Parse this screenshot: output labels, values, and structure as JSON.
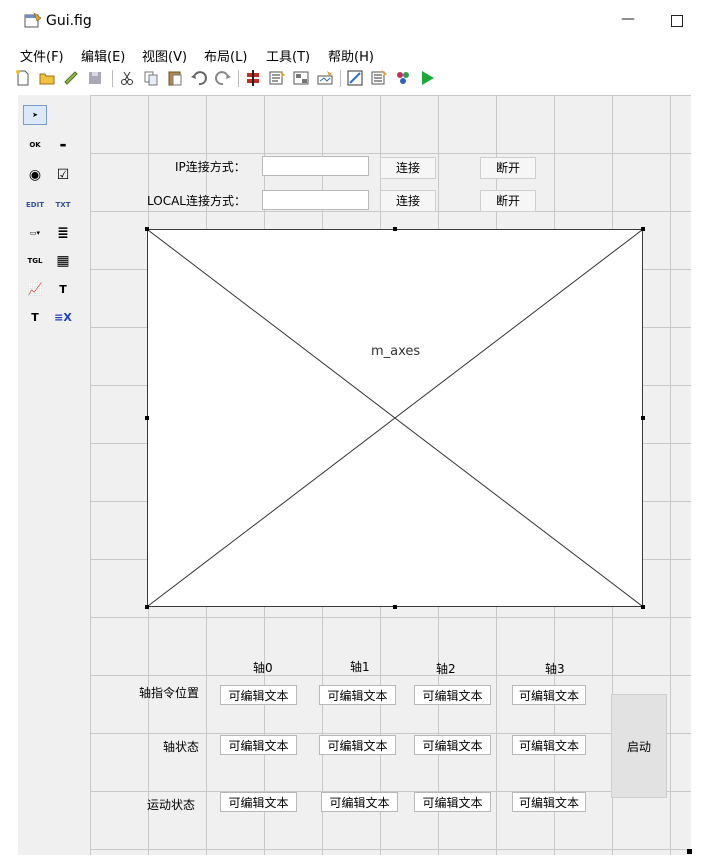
{
  "window": {
    "title": "Gui.fig",
    "minimize_glyph": "—"
  },
  "menu": [
    "文件(F)",
    "编辑(E)",
    "视图(V)",
    "布局(L)",
    "工具(T)",
    "帮助(H)"
  ],
  "toolbar_icons": [
    "new-file-icon",
    "open-folder-icon",
    "save-disk-icon",
    "cut-icon",
    "copy-icon",
    "paste-icon",
    "undo-icon",
    "redo-icon",
    "align-icon",
    "menu-editor-icon",
    "tab-order-icon",
    "toolbar-editor-icon",
    "editor-icon",
    "property-inspector-icon",
    "object-browser-icon",
    "run-icon"
  ],
  "palette": [
    {
      "name": "select-arrow-icon",
      "glyph": "➤"
    },
    {
      "name": "pushbutton-icon",
      "glyph": "OK"
    },
    {
      "name": "slider-icon",
      "glyph": "▬"
    },
    {
      "name": "radiobutton-icon",
      "glyph": "◉"
    },
    {
      "name": "checkbox-icon",
      "glyph": "☑"
    },
    {
      "name": "edit-text-icon",
      "glyph": "EDIT"
    },
    {
      "name": "static-text-icon",
      "glyph": "TXT"
    },
    {
      "name": "popup-menu-icon",
      "glyph": "▭▾"
    },
    {
      "name": "listbox-icon",
      "glyph": "≣"
    },
    {
      "name": "toggle-button-icon",
      "glyph": "TGL"
    },
    {
      "name": "table-icon",
      "glyph": "▦"
    },
    {
      "name": "axes-icon",
      "glyph": "📈"
    },
    {
      "name": "panel-icon",
      "glyph": "T"
    },
    {
      "name": "button-group-icon",
      "glyph": "T"
    },
    {
      "name": "activex-icon",
      "glyph": "≡X"
    }
  ],
  "connection": {
    "ip_label": "IP连接方式：",
    "local_label": "LOCAL连接方式：",
    "connect_label": "连接",
    "disconnect_label": "断开"
  },
  "axes": {
    "tag": "m_axes"
  },
  "axis_headers": [
    "轴0",
    "轴1",
    "轴2",
    "轴3"
  ],
  "rows": [
    {
      "label": "轴指令位置",
      "cells": [
        "可编辑文本",
        "可编辑文本",
        "可编辑文本",
        "可编辑文本"
      ]
    },
    {
      "label": "轴状态",
      "cells": [
        "可编辑文本",
        "可编辑文本",
        "可编辑文本",
        "可编辑文本"
      ]
    },
    {
      "label": "运动状态",
      "cells": [
        "可编辑文本",
        "可编辑文本",
        "可编辑文本",
        "可编辑文本"
      ]
    }
  ],
  "start_button": "启动",
  "colors": {
    "run_green": "#1aaa3a",
    "canvas_bg": "#f0f0f0",
    "grid": "#c8c8c8"
  }
}
